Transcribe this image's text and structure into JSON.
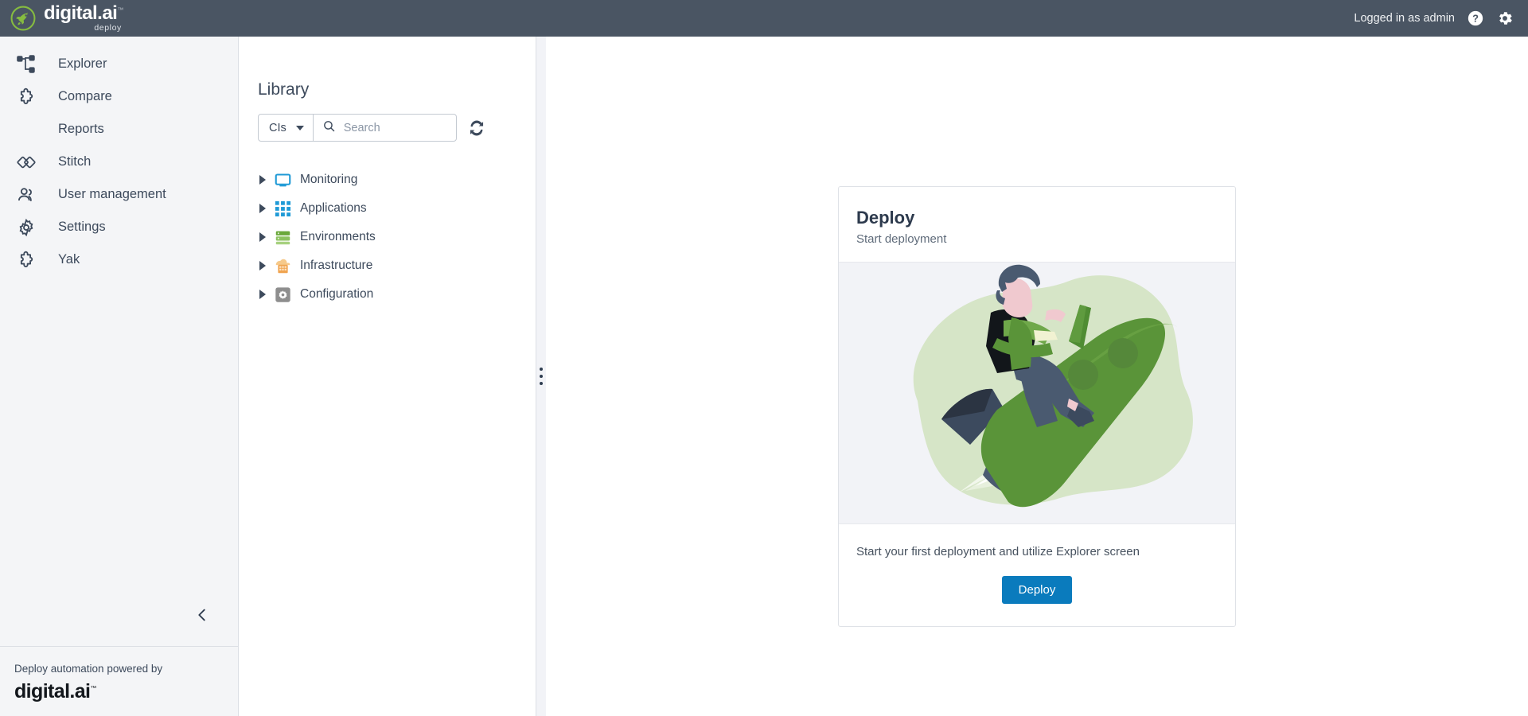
{
  "header": {
    "brand_name": "digital.ai",
    "brand_tm": "™",
    "brand_product": "deploy",
    "brand_icon": "rocket-logo-icon",
    "logged_in_text": "Logged in as admin",
    "help_icon": "help-circle-icon",
    "settings_icon": "gear-icon",
    "background_color": "#4a5563",
    "accent_green": "#86bc40"
  },
  "sidebar": {
    "items": [
      {
        "label": "Explorer",
        "icon": "sitemap-icon",
        "has_icon": true
      },
      {
        "label": "Compare",
        "icon": "puzzle-piece-icon",
        "has_icon": true
      },
      {
        "label": "Reports",
        "icon": "",
        "has_icon": false
      },
      {
        "label": "Stitch",
        "icon": "stitch-diamonds-icon",
        "has_icon": true
      },
      {
        "label": "User management",
        "icon": "users-icon",
        "has_icon": true
      },
      {
        "label": "Settings",
        "icon": "gear-icon",
        "has_icon": true
      },
      {
        "label": "Yak",
        "icon": "puzzle-piece-icon",
        "has_icon": true
      }
    ],
    "collapse_icon": "chevron-left-icon",
    "footer": {
      "powered_by_text": "Deploy automation powered by",
      "logo_text": "digital.ai",
      "logo_tm": "™"
    }
  },
  "library": {
    "title": "Library",
    "filter": {
      "selected": "CIs",
      "caret_icon": "chevron-down-icon"
    },
    "search": {
      "placeholder": "Search",
      "value": "",
      "icon": "search-icon"
    },
    "refresh_icon": "refresh-icon",
    "tree": [
      {
        "label": "Monitoring",
        "icon": "monitor-icon",
        "color": "#1f9ad6",
        "expanded": false
      },
      {
        "label": "Applications",
        "icon": "grid-apps-icon",
        "color": "#1f9ad6",
        "expanded": false
      },
      {
        "label": "Environments",
        "icon": "server-stack-icon",
        "color": "#6aa83a",
        "expanded": false
      },
      {
        "label": "Infrastructure",
        "icon": "infrastructure-icon",
        "color": "#f0a450",
        "expanded": false
      },
      {
        "label": "Configuration",
        "icon": "gear-square-icon",
        "color": "#8e8e8e",
        "expanded": false
      }
    ]
  },
  "splitter": {
    "handle_icon": "vertical-dots-icon"
  },
  "main": {
    "card": {
      "title": "Deploy",
      "subtitle": "Start deployment",
      "illustration": "rocket-rider-illustration",
      "body_text": "Start your first deployment and utilize Explorer screen",
      "button_label": "Deploy",
      "button_color": "#0a7bbd"
    }
  }
}
